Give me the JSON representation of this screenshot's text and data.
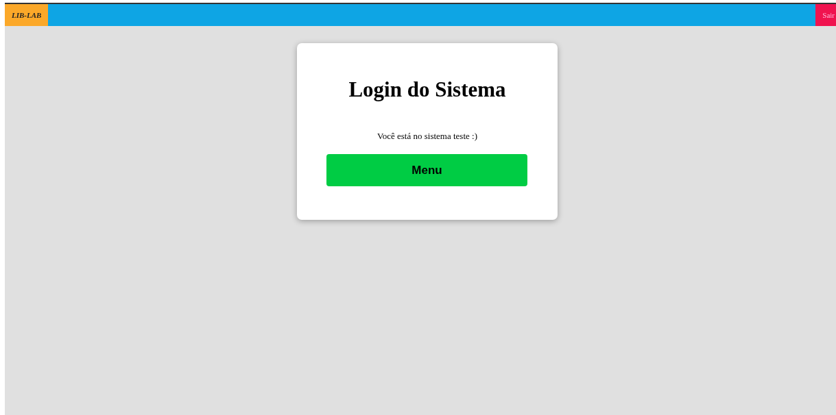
{
  "navbar": {
    "brand": "LIB-LAB",
    "logout": "Sair"
  },
  "login_card": {
    "title": "Login do Sistema",
    "message": "Você está no sistema teste :)",
    "button": "Menu"
  }
}
